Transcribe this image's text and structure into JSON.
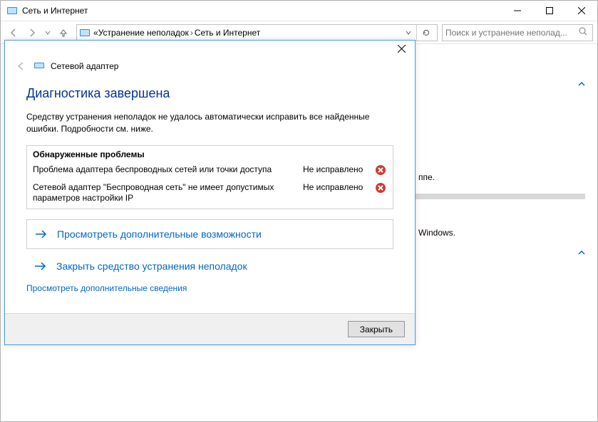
{
  "window": {
    "title": "Сеть и Интернет"
  },
  "breadcrumb": {
    "prefix": "«",
    "seg1": "Устранение неполадок",
    "seg2": "Сеть и Интернет"
  },
  "search": {
    "placeholder": "Поиск и устранение неполад..."
  },
  "body": {
    "frag1": "ппе.",
    "frag2": "Windows."
  },
  "dialog": {
    "header_title": "Сетевой адаптер",
    "heading": "Диагностика завершена",
    "desc": "Средству устранения неполадок не удалось автоматически исправить все найденные ошибки. Подробности см. ниже.",
    "problems_heading": "Обнаруженные проблемы",
    "problems": [
      {
        "text": "Проблема адаптера беспроводных сетей или точки доступа",
        "status": "Не исправлено"
      },
      {
        "text": "Сетевой адаптер \"Беспроводная сеть\" не имеет допустимых параметров настройки IP",
        "status": "Не исправлено"
      }
    ],
    "opt_more": "Просмотреть дополнительные возможности",
    "opt_close": "Закрыть средство устранения неполадок",
    "details_link": "Просмотреть дополнительные сведения",
    "close_btn": "Закрыть"
  }
}
